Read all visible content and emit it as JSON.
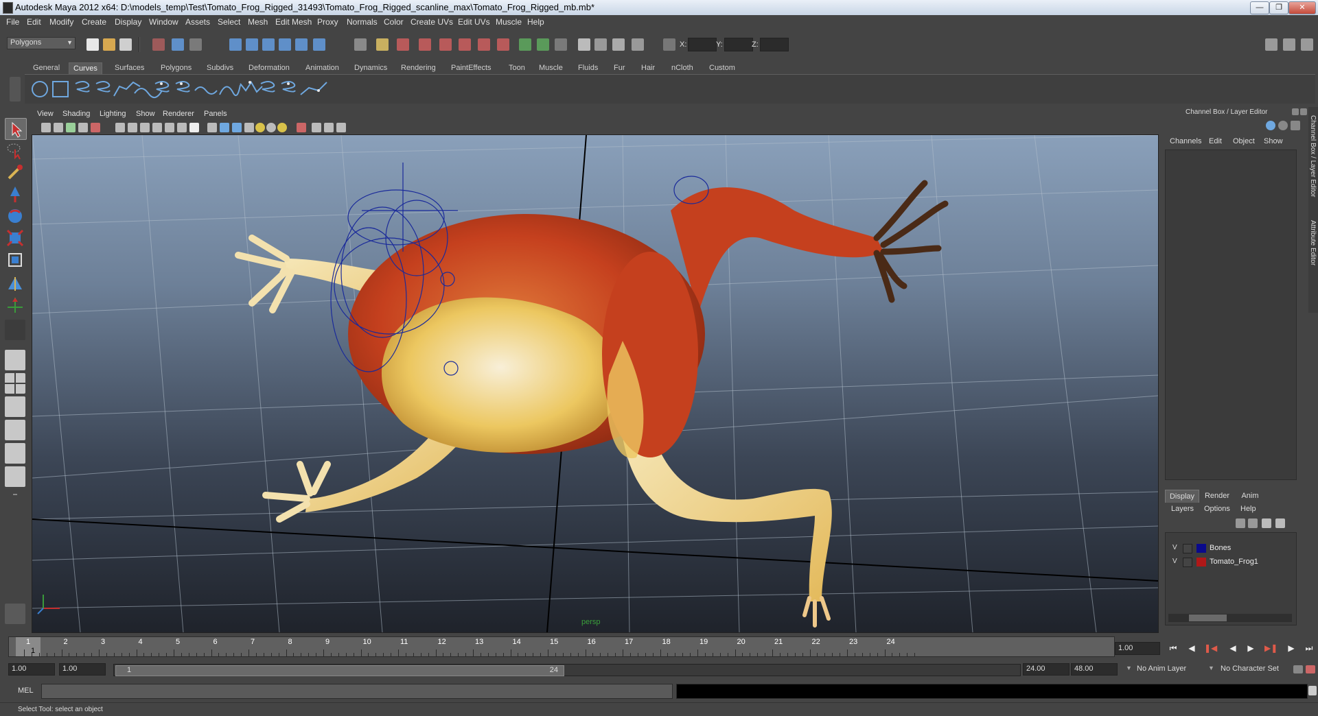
{
  "window": {
    "title": "Autodesk Maya 2012 x64: D:\\models_temp\\Test\\Tomato_Frog_Rigged_31493\\Tomato_Frog_Rigged_scanline_max\\Tomato_Frog_Rigged_mb.mb*"
  },
  "menubar": [
    "File",
    "Edit",
    "Modify",
    "Create",
    "Display",
    "Window",
    "Assets",
    "Select",
    "Mesh",
    "Edit Mesh",
    "Proxy",
    "Normals",
    "Color",
    "Create UVs",
    "Edit UVs",
    "Muscle",
    "Help"
  ],
  "statusline": {
    "mode": "Polygons",
    "x_label": "X:",
    "y_label": "Y:",
    "z_label": "Z:"
  },
  "shelf": {
    "tabs": [
      "General",
      "Curves",
      "Surfaces",
      "Polygons",
      "Subdivs",
      "Deformation",
      "Animation",
      "Dynamics",
      "Rendering",
      "PaintEffects",
      "Toon",
      "Muscle",
      "Fluids",
      "Fur",
      "Hair",
      "nCloth",
      "Custom"
    ],
    "active_tab": "Curves"
  },
  "viewport": {
    "menus": [
      "View",
      "Shading",
      "Lighting",
      "Show",
      "Renderer",
      "Panels"
    ],
    "camera_label": "persp"
  },
  "channel_box": {
    "title": "Channel Box / Layer Editor",
    "menus": [
      "Channels",
      "Edit",
      "Object",
      "Show"
    ],
    "side_tabs": [
      "Channel Box / Layer Editor",
      "Attribute Editor"
    ]
  },
  "layer_editor": {
    "tabs": [
      "Display",
      "Render",
      "Anim"
    ],
    "active_tab": "Display",
    "menus": [
      "Layers",
      "Options",
      "Help"
    ],
    "layers": [
      {
        "visible": "V",
        "name": "Bones",
        "color": "#0a0a8c"
      },
      {
        "visible": "V",
        "name": "Tomato_Frog1",
        "color": "#b01818"
      }
    ]
  },
  "timeline": {
    "ticks": [
      "1",
      "2",
      "3",
      "4",
      "5",
      "6",
      "7",
      "8",
      "9",
      "10",
      "11",
      "12",
      "13",
      "14",
      "15",
      "16",
      "17",
      "18",
      "19",
      "20",
      "21",
      "22",
      "23",
      "24"
    ],
    "current_frame": "1",
    "current_time": "1.00"
  },
  "range": {
    "start": "1.00",
    "playback_start": "1.00",
    "range_start_label": "1",
    "range_end_label": "24",
    "playback_end": "24.00",
    "end": "48.00",
    "anim_layer": "No Anim Layer",
    "character_set": "No Character Set"
  },
  "command_line": {
    "label": "MEL"
  },
  "help_line": "Select Tool: select an object",
  "colors": {
    "frog_red": "#c5401e",
    "frog_yellow": "#ecc760",
    "rig_blue": "#1a2a9a",
    "bg": "#444444"
  }
}
